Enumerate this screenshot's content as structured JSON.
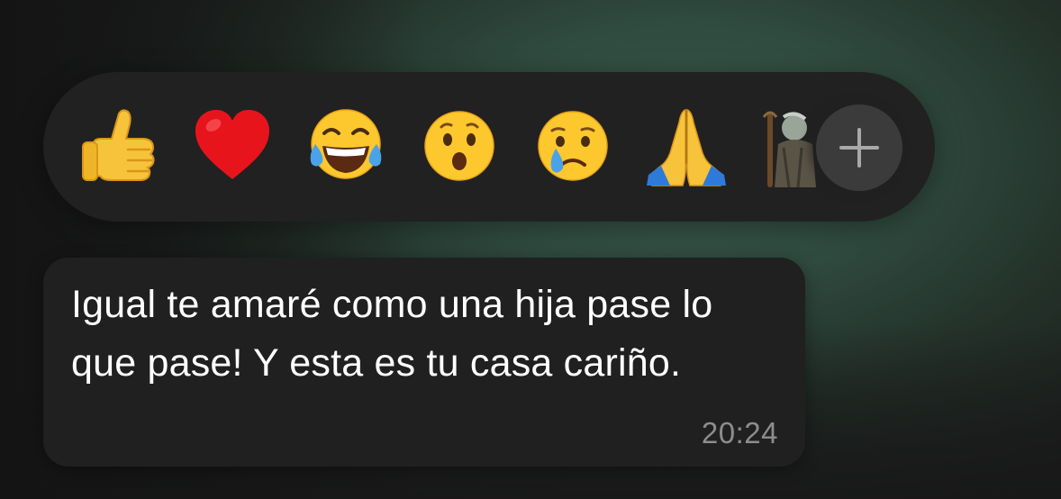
{
  "reaction_bar": {
    "reactions": [
      {
        "icon": "thumbs-up-icon"
      },
      {
        "icon": "red-heart-icon"
      },
      {
        "icon": "tears-of-joy-icon"
      },
      {
        "icon": "surprised-face-icon"
      },
      {
        "icon": "crying-face-icon"
      },
      {
        "icon": "folded-hands-icon"
      },
      {
        "icon": "custom-sticker-icon"
      }
    ],
    "add_button_icon": "plus-icon"
  },
  "message": {
    "text": "Igual te amaré como una hija pase lo que pase! Y esta es tu casa cariño.",
    "time": "20:24"
  },
  "colors": {
    "bubble": "#202020",
    "bar": "#212121",
    "add_button": "#3b3b3b",
    "time": "#8d8d8d"
  }
}
